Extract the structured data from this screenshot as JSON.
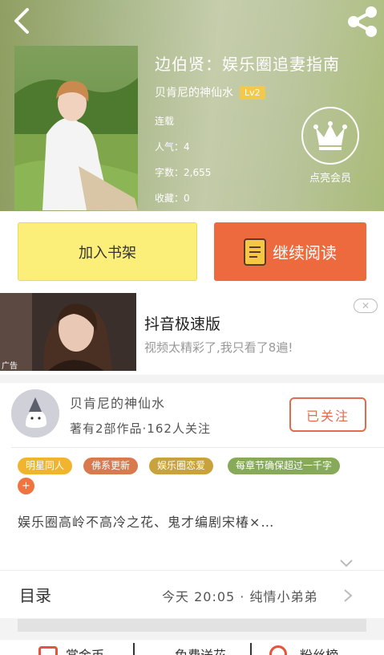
{
  "header": {
    "title": "边伯贤：娱乐圈追妻指南",
    "author": "贝肯尼的神仙水",
    "level": "Lv2",
    "status": "连载",
    "popularity": "人气：4",
    "word_count": "字数：2,655",
    "favorites": "收藏：0",
    "vip_label": "点亮会员",
    "icons": {
      "back": "chevron-left-icon",
      "share": "share-icon",
      "vip": "crown-icon"
    }
  },
  "actions": {
    "add_shelf": "加入书架",
    "continue_read": "继续阅读"
  },
  "ad": {
    "title": "抖音极速版",
    "desc": "视频太精彩了,我只看了8遍!",
    "tag": "广告"
  },
  "writer": {
    "name": "贝肯尼的神仙水",
    "stats": "著有2部作品·162人关注",
    "follow": "已关注"
  },
  "tags": [
    {
      "label": "明星同人",
      "color": "#f1b42f"
    },
    {
      "label": "佛系更新",
      "color": "#d97a4e"
    },
    {
      "label": "娱乐圈恋爱",
      "color": "#c9a23c"
    },
    {
      "label": "每章节确保超过一千字",
      "color": "#86a95a"
    }
  ],
  "tag_add": "+",
  "intro": "娱乐圈高岭不高冷之花、鬼才编剧宋椿×…",
  "toc": {
    "label": "目录",
    "latest": "今天 20:05 · 纯情小弟弟"
  },
  "bottom": [
    "赏金币",
    "免费送花",
    "粉丝榜"
  ],
  "colors": {
    "accent": "#ec6a3d",
    "shelf": "#fbef7a"
  }
}
